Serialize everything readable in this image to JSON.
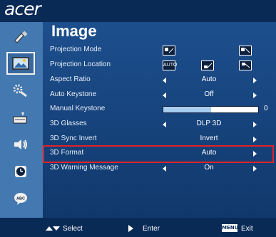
{
  "brand": "acer",
  "page_title": "Image",
  "sidebar": [
    {
      "icon": "color-palette-icon",
      "selected": false
    },
    {
      "icon": "image-icon",
      "selected": true
    },
    {
      "icon": "settings-gear-icon",
      "selected": false
    },
    {
      "icon": "projector-timer-icon",
      "selected": false
    },
    {
      "icon": "audio-speaker-icon",
      "selected": false
    },
    {
      "icon": "clock-icon",
      "selected": false
    },
    {
      "icon": "language-icon",
      "selected": false
    }
  ],
  "menu": {
    "projection_mode": {
      "label": "Projection Mode"
    },
    "projection_location": {
      "label": "Projection Location",
      "auto_label": "AUTO"
    },
    "aspect_ratio": {
      "label": "Aspect Ratio",
      "value": "Auto"
    },
    "auto_keystone": {
      "label": "Auto Keystone",
      "value": "Off"
    },
    "manual_keystone": {
      "label": "Manual Keystone",
      "value": "0"
    },
    "glasses_3d": {
      "label": "3D Glasses",
      "value": "DLP 3D"
    },
    "sync_invert_3d": {
      "label": "3D Sync Invert",
      "value": "Invert"
    },
    "format_3d": {
      "label": "3D Format",
      "value": "Auto"
    },
    "warning_3d": {
      "label": "3D Warning Message",
      "value": "On"
    }
  },
  "footer": {
    "select": "Select",
    "enter": "Enter",
    "menu_key": "MENU",
    "exit": "Exit"
  },
  "colors": {
    "header": "#0a2a56",
    "frame": "#4378b0",
    "panel": "#1d4f8d",
    "highlight": "#e0222a"
  }
}
